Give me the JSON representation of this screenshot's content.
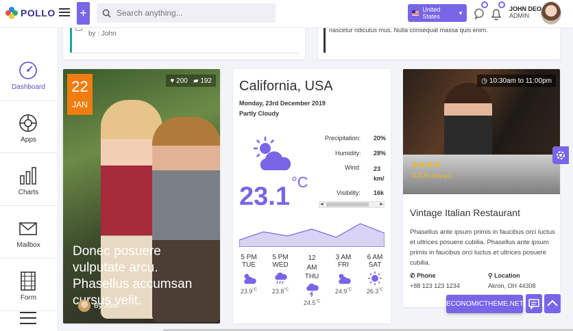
{
  "app": {
    "name": "POLLO"
  },
  "search": {
    "placeholder": "Search anything..."
  },
  "country": {
    "label": "United States",
    "flag_icon": "us-flag-icon"
  },
  "user": {
    "name": "JOHN DEO",
    "role": "ADMIN"
  },
  "sidebar": {
    "items": [
      {
        "label": "Dashboard",
        "icon": "speedometer-icon",
        "active": true
      },
      {
        "label": "Apps",
        "icon": "lifebuoy-icon",
        "active": false
      },
      {
        "label": "Charts",
        "icon": "bar-chart-icon",
        "active": false
      },
      {
        "label": "Mailbox",
        "icon": "envelope-icon",
        "active": false
      },
      {
        "label": "Form",
        "icon": "film-icon",
        "active": false
      }
    ]
  },
  "top_cards": {
    "left_by": "by : John",
    "right_text": "nascetur ridiculus mus. Nulla consequat massa quis enim."
  },
  "blog": {
    "day": "22",
    "month": "JAN",
    "likes": "200",
    "comments": "192",
    "title": "Donec posuere vulputate arcu. Phasellus accumsan cursus velit.",
    "author": "By John"
  },
  "weather": {
    "city": "California, USA",
    "date": "Monday, 23rd December 2019",
    "condition": "Partly Cloudy",
    "temperature": "23.1",
    "unit": "°C",
    "stats": [
      {
        "label": "Precipitation:",
        "value": "20%"
      },
      {
        "label": "Humidity:",
        "value": "28%"
      },
      {
        "label": "Wind:",
        "value": "23 km/"
      },
      {
        "label": "Visibility:",
        "value": "16k"
      }
    ],
    "trend": [
      10,
      22,
      16,
      26,
      14,
      34,
      20
    ],
    "forecast": [
      {
        "time": "5 PM",
        "day": "TUE",
        "temp": "23.9",
        "icon": "cloud-sun-icon"
      },
      {
        "time": "5 PM",
        "day": "WED",
        "temp": "23.8",
        "icon": "cloud-rain-icon"
      },
      {
        "time": "12 AM",
        "day": "THU",
        "temp": "24.5",
        "icon": "cloud-lightning-icon"
      },
      {
        "time": "3 AM",
        "day": "FRI",
        "temp": "24.9",
        "icon": "cloud-sun-icon"
      },
      {
        "time": "6 AM",
        "day": "SAT",
        "temp": "26.3",
        "icon": "sun-icon"
      }
    ],
    "temp_unit": "°C"
  },
  "restaurant": {
    "hours": "10:30am to 11:00pm",
    "stars": "★★★★",
    "rating": "3.5",
    "ratings_count": "(85 Ratings)",
    "name": "Vintage Italian Restaurant",
    "description": "Phasellus ante ipsum primis in faucibus orci luctus et ultrices posuere cubilia. Phasellus ante ipsum primis in faucibus orci luctus et ultrices posuere cubilia.",
    "phone_label": "Phone",
    "phone": "+88 123 123 1234",
    "location_label": "Location",
    "location": "Akron, OH 44308"
  },
  "promo": {
    "label": "ECONOMICTHEME.NET"
  },
  "colors": {
    "accent": "#7766e6",
    "badge": "#ef7d10",
    "star": "#f3b816"
  }
}
